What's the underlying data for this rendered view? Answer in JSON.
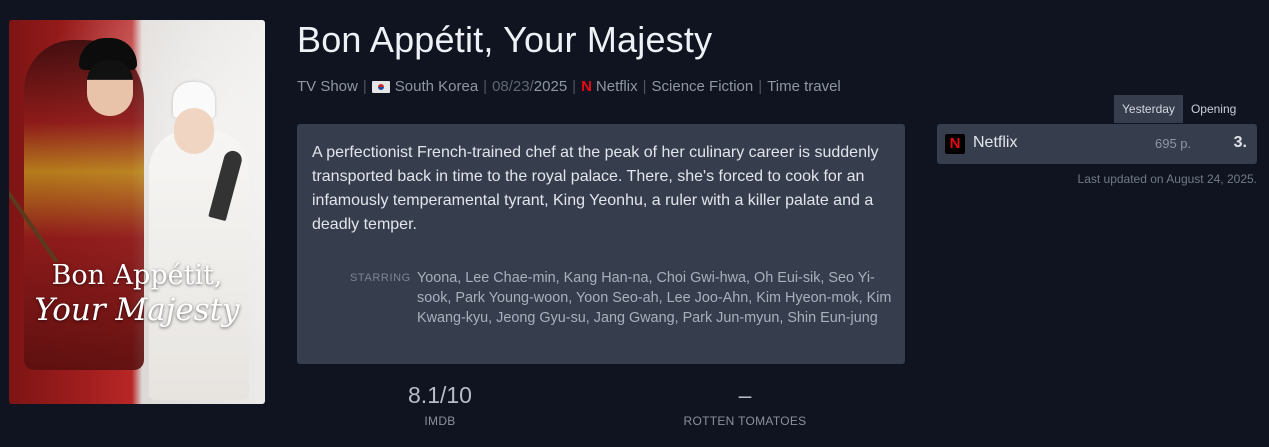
{
  "show": {
    "title": "Bon Appétit, Your Majesty",
    "poster": {
      "title_line1": "Bon Appétit,",
      "title_line2": "Your Majesty"
    },
    "meta": {
      "type": "TV Show",
      "country": "South Korea",
      "date_prefix": "08/23/",
      "date_year": "2025",
      "network": "Netflix",
      "genre": "Science Fiction",
      "subgenre": "Time travel"
    },
    "description": "A perfectionist French-trained chef at the peak of her culinary career is suddenly transported back in time to the royal palace. There, she's forced to cook for an infamously temperamental tyrant, King Yeonhu, a ruler with a killer palate and a deadly temper.",
    "starring_label": "STARRING",
    "starring": "Yoona, Lee Chae-min, Kang Han-na, Choi Gwi-hwa, Oh Eui-sik, Seo Yi-sook, Park Young-woon, Yoon Seo-ah, Lee Joo-Ahn, Kim Hyeon-mok, Kim Kwang-kyu, Jeong Gyu-su, Jang Gwang, Park Jun-myun, Shin Eun-jung",
    "ratings": {
      "imdb_value": "8.1/10",
      "imdb_label": "IMDB",
      "rt_value": "–",
      "rt_label": "ROTTEN TOMATOES"
    }
  },
  "ranking": {
    "tabs": [
      "Yesterday",
      "Opening"
    ],
    "active_tab": "Yesterday",
    "row": {
      "logo": "N",
      "service": "Netflix",
      "points": "695 p.",
      "rank": "3."
    },
    "updated": "Last updated on August 24, 2025."
  },
  "colors": {
    "netflix": "#e50914",
    "card": "#363d4c",
    "background": "#0f1420"
  },
  "icons": {
    "country_flag": "south-korea-flag-icon",
    "network": "netflix-logo-icon"
  }
}
